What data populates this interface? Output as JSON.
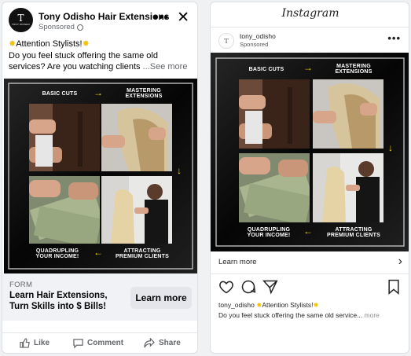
{
  "facebook": {
    "page_name": "Tony Odisho Hair Extensions",
    "sponsored": "Sponsored",
    "avatar_letter": "T",
    "avatar_wordmark": "TONY ODISHO",
    "body_line1": "Attention Stylists!",
    "body_line2": "Do you feel stuck offering the same old services? Are you watching clients",
    "see_more": "...See more",
    "form_label": "FORM",
    "headline": "Learn Hair Extensions, Turn Skills into $ Bills!",
    "cta": "Learn more",
    "actions": {
      "like": "Like",
      "comment": "Comment",
      "share": "Share"
    }
  },
  "instagram": {
    "logo": "Instagram",
    "username": "tony_odisho",
    "sponsored": "Sponsored",
    "cta": "Learn more",
    "caption_user": "tony_odisho",
    "caption_head": "Attention Stylists!",
    "caption_body": "Do you feel stuck offering the same old service...",
    "caption_more": "more"
  },
  "ad_creative": {
    "basic_cuts": "BASIC CUTS",
    "mastering_extensions": "MASTERING EXTENSIONS",
    "attracting_clients": "ATTRACTING PREMIUM CLIENTS",
    "quadrupling_income": "QUADRUPLING YOUR INCOME!"
  },
  "colors": {
    "arrow": "#f2d21b",
    "ad_bg": "#0a0a0a",
    "star": "#f5c400"
  },
  "icons": [
    "globe-icon",
    "more-icon",
    "close-icon",
    "like-icon",
    "comment-icon",
    "share-icon",
    "heart-icon",
    "chat-icon",
    "send-icon",
    "bookmark-icon",
    "chevron-right-icon"
  ]
}
